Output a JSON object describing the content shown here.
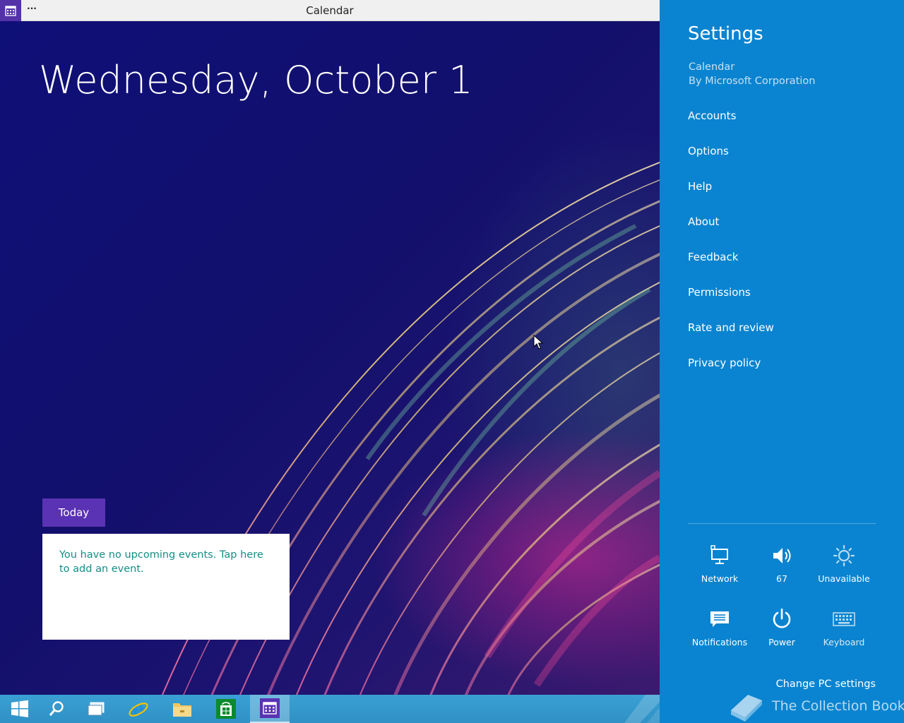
{
  "window": {
    "title": "Calendar",
    "more_label": "···",
    "app_icon": "calendar-icon"
  },
  "calendar": {
    "date_heading": "Wednesday, October 1",
    "today_button": "Today",
    "no_events_text": "You have no upcoming events. Tap here to add an event."
  },
  "taskbar": {
    "items": [
      {
        "name": "start-button",
        "icon": "windows-logo-icon"
      },
      {
        "name": "search-button",
        "icon": "search-icon"
      },
      {
        "name": "task-view-button",
        "icon": "task-view-icon"
      },
      {
        "name": "internet-explorer-button",
        "icon": "internet-explorer-icon"
      },
      {
        "name": "file-explorer-button",
        "icon": "folder-icon"
      },
      {
        "name": "store-button",
        "icon": "store-icon"
      },
      {
        "name": "calendar-taskbar-button",
        "icon": "calendar-icon",
        "active": true
      }
    ]
  },
  "settings": {
    "title": "Settings",
    "app_name": "Calendar",
    "publisher": "By Microsoft Corporation",
    "menu": [
      "Accounts",
      "Options",
      "Help",
      "About",
      "Feedback",
      "Permissions",
      "Rate and review",
      "Privacy policy"
    ],
    "quick": {
      "network": "Network",
      "volume": "67",
      "brightness": "Unavailable",
      "notifications": "Notifications",
      "power": "Power",
      "keyboard": "Keyboard"
    },
    "change_pc_settings": "Change PC settings"
  },
  "watermark": "The Collection Book",
  "colors": {
    "charm_background": "#0a84d0",
    "accent_purple": "#5a32b4",
    "event_text": "#138f86",
    "taskbar": "#3aa0d3"
  }
}
